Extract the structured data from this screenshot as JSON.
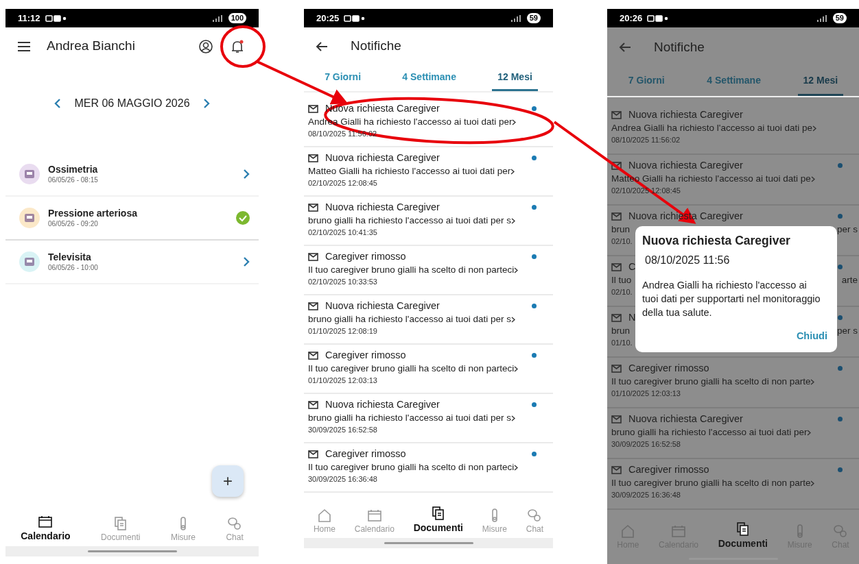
{
  "phones": [
    {
      "kind": "calendar",
      "dimmed": false,
      "status_bar": {
        "time": "11:12",
        "battery": "100"
      },
      "title": "Andrea Bianchi",
      "notification_dot": true,
      "date": "MER 06 MAGGIO 2026",
      "events": [
        {
          "name": "Ossimetria",
          "time": "06/05/26 - 08:15",
          "color": "#e9dcf0",
          "done": false
        },
        {
          "name": "Pressione arteriosa",
          "time": "06/05/26 - 09:20",
          "color": "#fbe8c8",
          "done": true
        },
        {
          "name": "Televisita",
          "time": "06/05/26 - 10:00",
          "color": "#d9f3f5",
          "done": false
        }
      ],
      "fab": "+",
      "nav": [
        {
          "label": "Calendario",
          "selected": true
        },
        {
          "label": "Documenti",
          "selected": false
        },
        {
          "label": "Misure",
          "selected": false
        },
        {
          "label": "Chat",
          "selected": false
        }
      ]
    },
    {
      "kind": "notifications",
      "dimmed": false,
      "status_bar": {
        "time": "20:25",
        "battery": "59"
      },
      "title": "Notifiche",
      "tabs": [
        {
          "label": "7 Giorni",
          "selected": false
        },
        {
          "label": "4 Settimane",
          "selected": false
        },
        {
          "label": "12 Mesi",
          "selected": true
        }
      ],
      "items": [
        {
          "title": "Nuova richiesta Caregiver",
          "body": "Andrea Gialli ha richiesto l'accesso ai tuoi dati per",
          "date": "08/10/2025 11:56:02",
          "unread": true
        },
        {
          "title": "Nuova richiesta Caregiver",
          "body": "Matteo Gialli ha richiesto l'accesso ai tuoi dati per",
          "date": "02/10/2025 12:08:45",
          "unread": true
        },
        {
          "title": "Nuova richiesta Caregiver",
          "body": "bruno gialli ha richiesto l'accesso ai tuoi dati per s",
          "date": "02/10/2025 10:41:35",
          "unread": true
        },
        {
          "title": "Caregiver rimosso",
          "body": "Il tuo caregiver bruno gialli ha scelto di non parteci",
          "date": "02/10/2025 10:33:53",
          "unread": true
        },
        {
          "title": "Nuova richiesta Caregiver",
          "body": "bruno gialli ha richiesto l'accesso ai tuoi dati per s",
          "date": "01/10/2025 12:08:19",
          "unread": true
        },
        {
          "title": "Caregiver rimosso",
          "body": "Il tuo caregiver bruno gialli ha scelto di non parteci",
          "date": "01/10/2025 12:03:13",
          "unread": true
        },
        {
          "title": "Nuova richiesta Caregiver",
          "body": "bruno gialli ha richiesto l'accesso ai tuoi dati per s",
          "date": "30/09/2025 16:52:58",
          "unread": true
        },
        {
          "title": "Caregiver rimosso",
          "body": "Il tuo caregiver bruno gialli ha scelto di non parteci",
          "date": "30/09/2025 16:36:48",
          "unread": true
        }
      ],
      "nav": [
        {
          "label": "Home",
          "selected": false
        },
        {
          "label": "Calendario",
          "selected": false
        },
        {
          "label": "Documenti",
          "selected": true
        },
        {
          "label": "Misure",
          "selected": false
        },
        {
          "label": "Chat",
          "selected": false
        }
      ]
    },
    {
      "kind": "notifications",
      "dimmed": true,
      "status_bar": {
        "time": "20:26",
        "battery": "59"
      },
      "title": "Notifiche",
      "tabs": [
        {
          "label": "7 Giorni",
          "selected": false
        },
        {
          "label": "4 Settimane",
          "selected": false
        },
        {
          "label": "12 Mesi",
          "selected": true
        }
      ],
      "items": [
        {
          "title": "Nuova richiesta Caregiver",
          "body": "Andrea Gialli ha richiesto l'accesso ai tuoi dati pe",
          "date": "08/10/2025 11:56:02",
          "unread": false
        },
        {
          "title": "Nuova richiesta Caregiver",
          "body": "Matteo Gialli ha richiesto l'accesso ai tuoi dati pe",
          "date": "02/10/2025 12:08:45",
          "unread": true
        },
        {
          "title": "Nuova richiesta Caregiver",
          "body": "brun",
          "body_end": "per s",
          "date": "02/10.",
          "unread": true
        },
        {
          "title": "C",
          "body": "Il tuo",
          "body_end": "arte",
          "date": "02/10.",
          "unread": true
        },
        {
          "title": "N",
          "body": "brun",
          "body_end": "per s",
          "date": "01/10.",
          "unread": true
        },
        {
          "title": "Caregiver rimosso",
          "body": "Il tuo caregiver bruno gialli ha scelto di non parte",
          "date": "01/10/2025 12:03:13",
          "unread": true
        },
        {
          "title": "Nuova richiesta Caregiver",
          "body": "bruno gialli ha richiesto l'accesso ai tuoi dati per",
          "date": "30/09/2025 16:52:58",
          "unread": true
        },
        {
          "title": "Caregiver rimosso",
          "body": "Il tuo caregiver bruno gialli ha scelto di non parte",
          "date": "30/09/2025 16:36:48",
          "unread": true
        }
      ],
      "dialog": {
        "title": "Nuova richiesta Caregiver",
        "date": "08/10/2025 11:56",
        "message": "Andrea Gialli ha richiesto l'accesso ai tuoi dati per supportarti nel monitoraggio della tua salute.",
        "button": "Chiudi"
      },
      "nav": [
        {
          "label": "Home",
          "selected": false
        },
        {
          "label": "Calendario",
          "selected": false
        },
        {
          "label": "Documenti",
          "selected": true
        },
        {
          "label": "Misure",
          "selected": false
        },
        {
          "label": "Chat",
          "selected": false
        }
      ]
    }
  ]
}
